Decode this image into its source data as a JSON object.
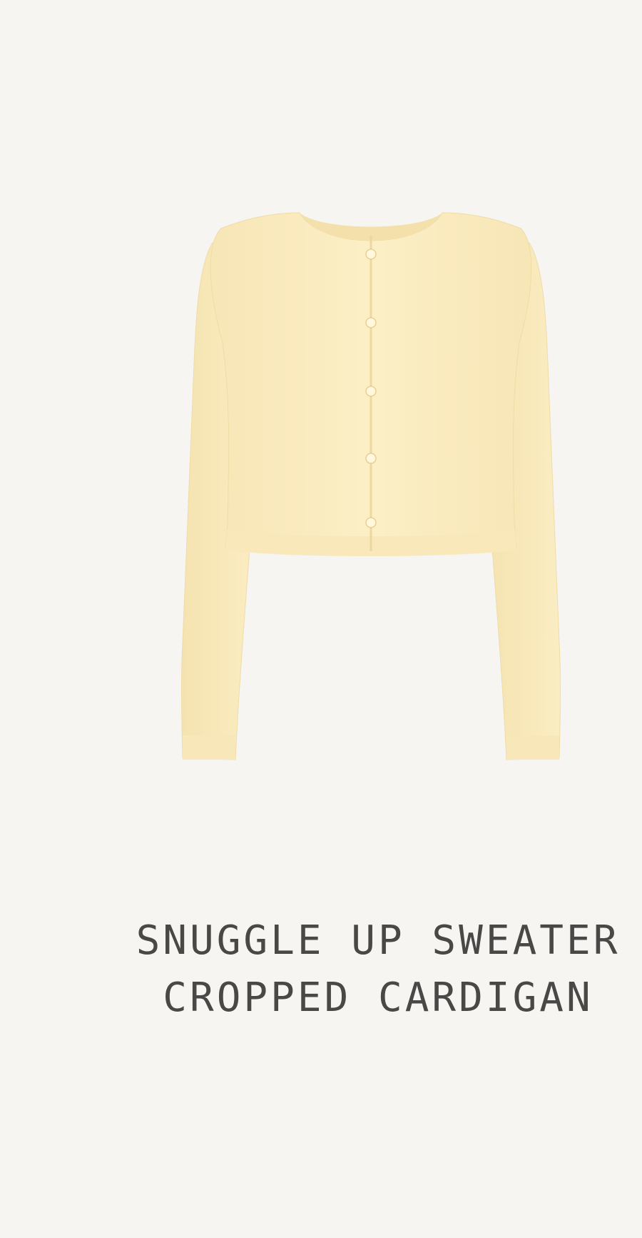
{
  "product": {
    "title": "SNUGGLE UP SWEATER CROPPED CARDIGAN",
    "image_alt": "Snuggle Up Sweater Cropped Cardigan",
    "image_icon": "cardigan-product-image",
    "garment_color": "#fbeec2",
    "background_color": "#f6f5f2",
    "title_color": "#4a4846"
  }
}
